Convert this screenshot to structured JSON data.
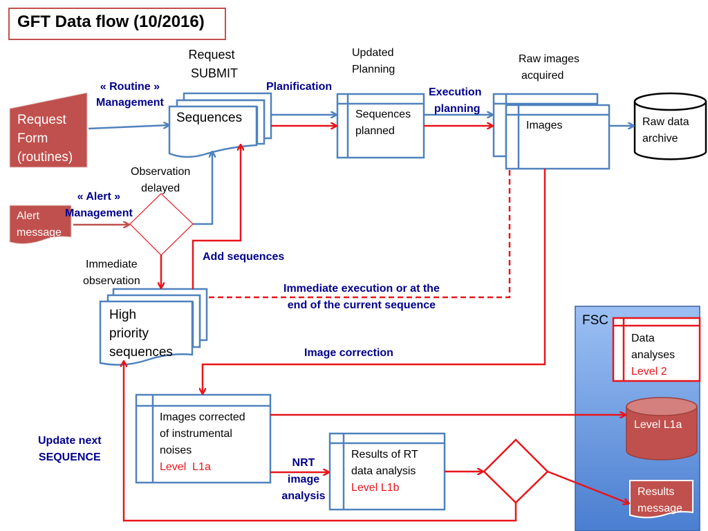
{
  "title": "GFT Data flow (10/2016)",
  "colors": {
    "blue_line": "#4f81bd",
    "red_line": "#e8141b",
    "brick": "#c0504d",
    "dark_blue_text": "#00008b",
    "fsc_panel_top": "#93b8f0",
    "fsc_panel_bottom": "#4a7ed0"
  },
  "nodes": {
    "request_form": {
      "lines": [
        "Request",
        "Form",
        "(routines)"
      ]
    },
    "alert_message": {
      "lines": [
        "Alert",
        "message"
      ]
    },
    "sequences": {
      "label": "Sequences"
    },
    "sequences_planned": {
      "lines": [
        "Sequences",
        "planned"
      ]
    },
    "images": {
      "label": "Images"
    },
    "raw_data_archive": {
      "lines": [
        "Raw data",
        "archive"
      ]
    },
    "high_priority": {
      "lines": [
        "High",
        "priority",
        "sequences"
      ]
    },
    "images_corrected": {
      "lines": [
        "Images corrected",
        "of instrumental",
        "noises"
      ],
      "level": "Level  L1a"
    },
    "rt_results": {
      "lines": [
        "Results of RT",
        "data analysis"
      ],
      "level": "Level L1b"
    },
    "fsc": {
      "label": "FSC",
      "data_analyses": {
        "lines": [
          "Data",
          "analyses"
        ],
        "level": "Level 2"
      },
      "level_l1a_db": "Level L1a",
      "results_message": {
        "lines": [
          "Results",
          "message"
        ]
      }
    }
  },
  "annotations": {
    "request_submit": [
      "Request",
      "SUBMIT"
    ],
    "updated_planning": [
      "Updated",
      "Planning"
    ],
    "raw_images_acquired": [
      "Raw images",
      "acquired"
    ],
    "routine_management": [
      "« Routine »",
      "Management"
    ],
    "planification": "Planification",
    "execution_planning": [
      "Execution",
      "planning"
    ],
    "observation_delayed": [
      "Observation",
      "delayed"
    ],
    "alert_management": [
      "« Alert »",
      "Management"
    ],
    "immediate_observation": [
      "Immediate",
      "observation"
    ],
    "add_sequences": "Add sequences",
    "immediate_execution": [
      "Immediate execution or at the",
      "end of the current sequence"
    ],
    "image_correction": "Image correction",
    "update_next_sequence": [
      "Update next",
      "SEQUENCE"
    ],
    "nrt_image_analysis": [
      "NRT",
      "image",
      "analysis"
    ]
  }
}
